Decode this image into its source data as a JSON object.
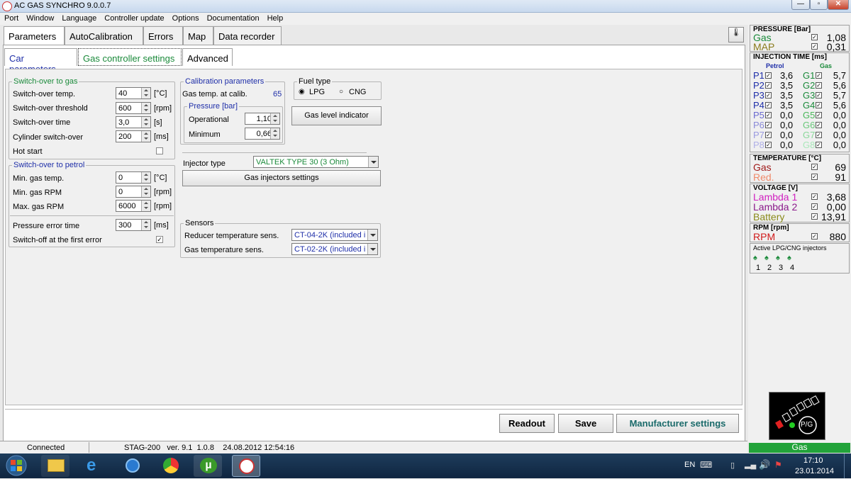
{
  "window": {
    "title": "AC GAS SYNCHRO  9.0.0.7"
  },
  "menu": [
    "Port",
    "Window",
    "Language",
    "Controller update",
    "Options",
    "Documentation",
    "Help"
  ],
  "main_tabs": [
    "Parameters",
    "AutoCalibration",
    "Errors",
    "Map",
    "Data recorder"
  ],
  "sub_tabs": [
    "Car parameters",
    "Gas controller settings",
    "Advanced"
  ],
  "switch_to_gas": {
    "title": "Switch-over to gas",
    "rows": [
      {
        "label": "Switch-over temp.",
        "value": "40",
        "unit": "[°C]"
      },
      {
        "label": "Switch-over threshold",
        "value": "600",
        "unit": "[rpm]"
      },
      {
        "label": "Switch-over time",
        "value": "3,0",
        "unit": "[s]"
      },
      {
        "label": "Cylinder switch-over",
        "value": "200",
        "unit": "[ms]"
      }
    ],
    "hot_start": "Hot start"
  },
  "switch_to_petrol": {
    "title": "Switch-over to petrol",
    "rows": [
      {
        "label": "Min. gas temp.",
        "value": "0",
        "unit": "[°C]"
      },
      {
        "label": "Min. gas RPM",
        "value": "0",
        "unit": "[rpm]"
      },
      {
        "label": "Max. gas RPM",
        "value": "6000",
        "unit": "[rpm]"
      }
    ],
    "pressure_error_label": "Pressure error time",
    "pressure_error_value": "300",
    "pressure_error_unit": "[ms]",
    "switch_off_label": "Switch-off at the first error"
  },
  "calibration": {
    "title": "Calibration parameters",
    "gas_temp_label": "Gas temp. at calib.",
    "gas_temp_value": "65",
    "pressure_title": "Pressure [bar]",
    "operational_label": "Operational",
    "operational_value": "1,10",
    "minimum_label": "Minimum",
    "minimum_value": "0,66"
  },
  "fuel_type": {
    "title": "Fuel type",
    "lpg": "LPG",
    "cng": "CNG"
  },
  "gas_level_button": "Gas level indicator",
  "injector_type": {
    "label": "Injector type",
    "value": "VALTEK TYPE 30 (3 Ohm)"
  },
  "gas_injectors_button": "Gas injectors settings",
  "sensors": {
    "title": "Sensors",
    "reducer_label": "Reducer temperature sens.",
    "reducer_value": "CT-04-2K (included i",
    "gas_label": "Gas temperature sens.",
    "gas_value": "CT-02-2K (included i"
  },
  "bottom_buttons": {
    "readout": "Readout",
    "save": "Save",
    "manufacturer": "Manufacturer settings"
  },
  "status_bar": {
    "connection": "Connected",
    "device": "STAG-200   ver. 9.1  1.0.8    24.08.2012 12:54:16",
    "mode": "Gas"
  },
  "right_panel": {
    "pressure": {
      "title": "PRESSURE [Bar]",
      "gas_label": "Gas",
      "gas_value": "1,08",
      "map_label": "MAP",
      "map_value": "0,31"
    },
    "injection": {
      "title": "INJECTION TIME [ms]",
      "petrol_header": "Petrol",
      "gas_header": "Gas",
      "petrol": [
        {
          "label": "P1",
          "value": "3,6"
        },
        {
          "label": "P2",
          "value": "3,5"
        },
        {
          "label": "P3",
          "value": "3,5"
        },
        {
          "label": "P4",
          "value": "3,5"
        },
        {
          "label": "P5",
          "value": "0,0"
        },
        {
          "label": "P6",
          "value": "0,0"
        },
        {
          "label": "P7",
          "value": "0,0"
        },
        {
          "label": "P8",
          "value": "0,0"
        }
      ],
      "gas": [
        {
          "label": "G1",
          "value": "5,7"
        },
        {
          "label": "G2",
          "value": "5,6"
        },
        {
          "label": "G3",
          "value": "5,7"
        },
        {
          "label": "G4",
          "value": "5,6"
        },
        {
          "label": "G5",
          "value": "0,0"
        },
        {
          "label": "G6",
          "value": "0,0"
        },
        {
          "label": "G7",
          "value": "0,0"
        },
        {
          "label": "G8",
          "value": "0,0"
        }
      ]
    },
    "temperature": {
      "title": "TEMPERATURE [°C]",
      "gas_label": "Gas",
      "gas_value": "69",
      "red_label": "Red.",
      "red_value": "91"
    },
    "voltage": {
      "title": "VOLTAGE [V]",
      "l1_label": "Lambda 1",
      "l1_value": "3,68",
      "l2_label": "Lambda 2",
      "l2_value": "0,00",
      "bat_label": "Battery",
      "bat_value": "13,91"
    },
    "rpm": {
      "title": "RPM [rpm]",
      "label": "RPM",
      "value": "880"
    },
    "injectors": {
      "title": "Active LPG/CNG injectors",
      "numbers": [
        "1",
        "2",
        "3",
        "4"
      ]
    },
    "pg_button": "P/G"
  },
  "taskbar": {
    "lang": "EN",
    "time": "17:10",
    "date": "23.01.2014"
  },
  "colors": {
    "green": "#1a8a3a",
    "blue": "#1e2ea8",
    "status_green": "#22a33a"
  }
}
